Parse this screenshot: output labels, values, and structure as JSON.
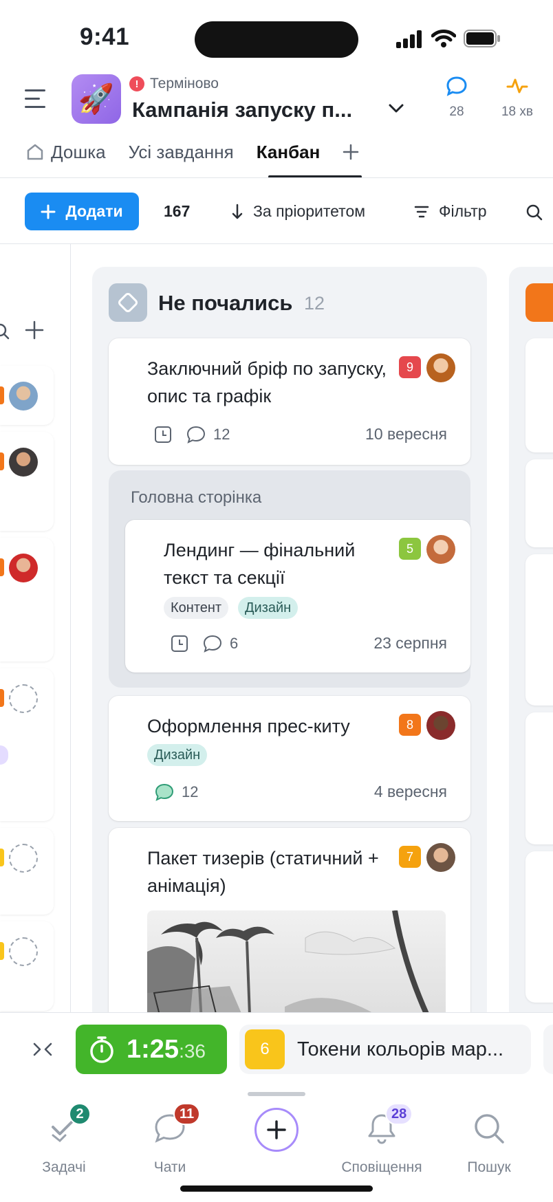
{
  "status_bar": {
    "time": "9:41"
  },
  "header": {
    "urgency_label": "Терміново",
    "project_title": "Кампанія запуску п...",
    "comments_count": "28",
    "activity_time": "18 хв"
  },
  "tabs": [
    {
      "label": "Дошка",
      "active": false
    },
    {
      "label": "Усі завдання",
      "active": false
    },
    {
      "label": "Канбан",
      "active": true
    }
  ],
  "toolbar": {
    "add_label": "Додати",
    "count": "167",
    "sort_label": "За пріоритетом",
    "filter_label": "Фільтр"
  },
  "column": {
    "title": "Не почались",
    "count": "12",
    "cards": [
      {
        "title": "Заключний бріф по запуску, опис та графік",
        "priority": "9",
        "priority_color": "#e5484d",
        "comments": "12",
        "date": "10 вересня"
      },
      {
        "group": "Головна сторінка",
        "title": "Лендинг — фінальний текст та секції",
        "priority": "5",
        "priority_color": "#8cc63f",
        "tags": [
          "Контент",
          "Дизайн"
        ],
        "comments": "6",
        "date": "23 серпня"
      },
      {
        "title": "Оформлення прес-киту",
        "priority": "8",
        "priority_color": "#f2761a",
        "tags": [
          "Дизайн"
        ],
        "comments": "12",
        "date": "4 вересня"
      },
      {
        "title": "Пакет тизерів (статичний + анімація)",
        "priority": "7",
        "priority_color": "#f5a20f"
      }
    ]
  },
  "timer": {
    "main": "1:25",
    "seconds": ":36"
  },
  "current_task": {
    "number": "6",
    "title": "Токени кольорів мар..."
  },
  "tabbar": [
    {
      "label": "Задачі",
      "badge": "2",
      "badge_color": "#1f8a70"
    },
    {
      "label": "Чати",
      "badge": "11",
      "badge_color": "#c0392b"
    },
    {
      "label": "Сповіщення",
      "badge": "28",
      "badge_color": "#e6e0ff"
    },
    {
      "label": "Пошук"
    }
  ],
  "colors": {
    "accent": "#1a8cf2",
    "timer": "#43b52a",
    "urgent": "#ef4d5a"
  }
}
